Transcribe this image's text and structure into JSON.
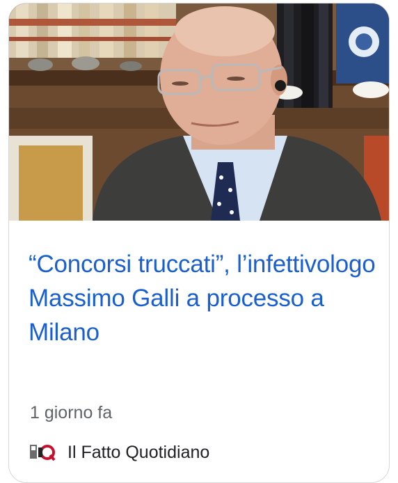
{
  "article": {
    "headline": "“Concorsi truccati”, l’infettivologo Massimo Galli a processo a Milano",
    "time_ago": "1 giorno fa",
    "source_name": "Il Fatto Quotidiano",
    "image_icon": "news-photo",
    "source_icon": "il-fatto-quotidiano-logo"
  },
  "colors": {
    "headline": "#1a5fd0",
    "meta": "#5f6368",
    "card_border": "#d6d6d6"
  }
}
